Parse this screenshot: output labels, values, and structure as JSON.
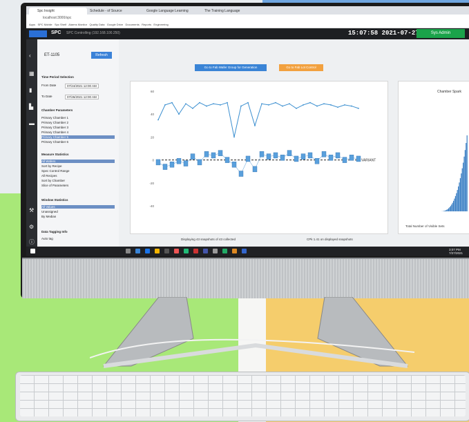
{
  "browser": {
    "tabs": [
      {
        "label": "Spc Insight"
      },
      {
        "label": "Schedule - of Source"
      },
      {
        "label": "Google Language Learning"
      },
      {
        "label": "The Training Language"
      }
    ],
    "url": "localhost:3000/spc",
    "bookmarks": [
      "Apps",
      "SPC Mobile",
      "Spc Shelf",
      "Alarms Monitor",
      "Quality Data",
      "Google Drive",
      "Documents",
      "Reports",
      "Engineering"
    ]
  },
  "app": {
    "title": "SPC",
    "subtitle": "SPC Controlling (192.168.100.250)",
    "clock": "15:07:58 2021-07-27",
    "system_button": "Sys Admin"
  },
  "panel": {
    "tool_id": "ET-1105",
    "refresh": "Refresh",
    "time_period_title": "Time Period Selection",
    "from_label": "From Date",
    "from_value": "07/24/2021 12:00 AM",
    "to_label": "To Date",
    "to_value": "07/26/2021 12:00 AM",
    "chamber_title": "Chamber Parameters",
    "chambers": [
      "Primary Chamber 1",
      "Primary Chamber 2",
      "Primary Chamber 3",
      "Primary Chamber 4",
      "Primary Chamber 5",
      "Primary Chamber 6"
    ],
    "selected_chamber_index": 4,
    "measure_title": "Measure Statistics",
    "measures": [
      "All Wafers",
      "Sort by Recipe",
      "Spec Control Range",
      "All Recipes",
      "Sort by Chamber",
      "Slice of Parameters"
    ],
    "window_title": "Window Statistics",
    "windows": [
      "All Values",
      "Unassigned",
      "By Median"
    ],
    "subset_title": "Data Tagging Info",
    "subset_item": "Auto tag"
  },
  "main": {
    "btn_blue": "Go to Fab Wafer Group for Generation",
    "btn_orange": "Go to Fab Lot Control",
    "footer_left": "Displaying 43 snapshots of 43 collected",
    "footer_right": "CPk 1.41 on displayed snapshots",
    "chart2_title": "Chamber Spark",
    "chart2_footer": "Total Number of Visible Sets"
  },
  "chart_data": {
    "type": "line",
    "x": [
      1,
      2,
      3,
      4,
      5,
      6,
      7,
      8,
      9,
      10,
      11,
      12,
      13,
      14,
      15,
      16,
      17,
      18,
      19,
      20,
      21,
      22,
      23,
      24,
      25,
      26,
      27,
      28,
      29,
      30
    ],
    "series": [
      {
        "values": [
          35,
          48,
          50,
          40,
          49,
          45,
          50,
          47,
          49,
          48,
          50,
          20,
          47,
          50,
          30,
          49,
          48,
          50,
          47,
          49,
          45,
          48,
          50,
          47,
          49,
          48,
          46,
          48,
          47,
          45
        ]
      },
      {
        "values": [
          -2,
          -6,
          -4,
          -1,
          -3,
          3,
          -2,
          5,
          4,
          6,
          0,
          -4,
          -12,
          1,
          -8,
          5,
          3,
          4,
          2,
          6,
          1,
          3,
          4,
          -1,
          5,
          2,
          4,
          0,
          2,
          1
        ]
      }
    ],
    "ylim": [
      -40,
      60
    ],
    "reference_label": "VARIANT"
  },
  "taskbar": {
    "time": "3:07 PM",
    "date": "7/27/2021"
  },
  "colors": {
    "accent_blue": "#3a84d6",
    "accent_orange": "#f2a13f",
    "system_green": "#1aa34a"
  }
}
